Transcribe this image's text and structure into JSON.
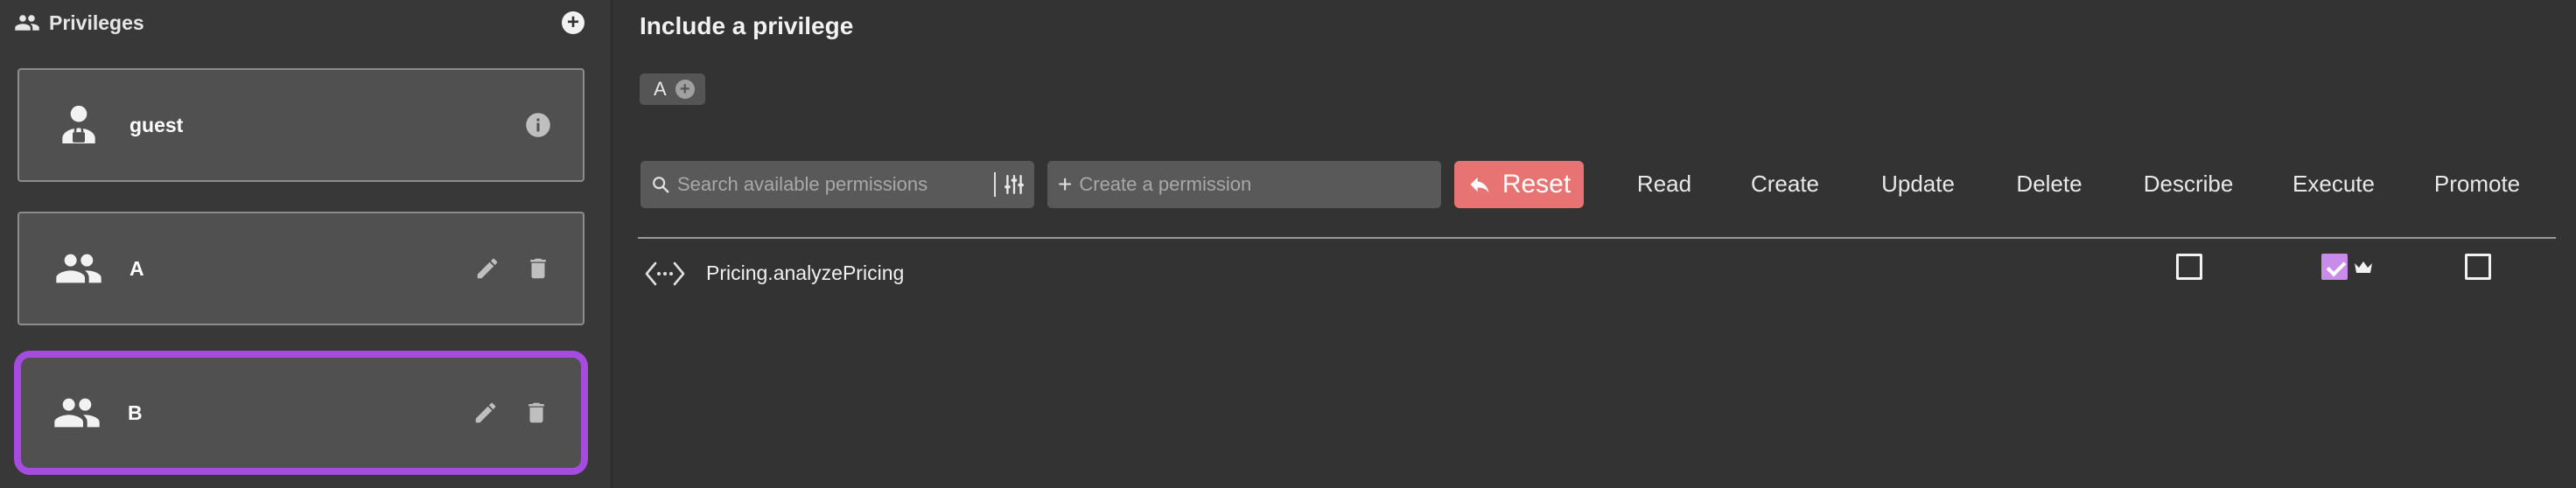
{
  "sidebar": {
    "title": "Privileges",
    "roles": [
      {
        "name": "guest",
        "icon": "user-lock-icon",
        "actions": [
          "info-icon"
        ]
      },
      {
        "name": "A",
        "icon": "group-icon",
        "actions": [
          "edit-icon",
          "delete-icon"
        ]
      },
      {
        "name": "B",
        "icon": "group-icon",
        "actions": [
          "edit-icon",
          "delete-icon"
        ],
        "selected": true
      }
    ]
  },
  "main": {
    "title": "Include a privilege",
    "chips": [
      {
        "label": "A"
      }
    ],
    "search": {
      "placeholder": "Search available permissions"
    },
    "create": {
      "placeholder": "Create a permission"
    },
    "reset_label": "Reset",
    "columns": [
      "Read",
      "Create",
      "Update",
      "Delete",
      "Describe",
      "Execute",
      "Promote"
    ],
    "permissions": [
      {
        "name": "Pricing.analyzePricing",
        "icon": "code-icon",
        "checkboxes": [
          {
            "column": "Describe",
            "checked": false
          },
          {
            "column": "Execute",
            "checked": true,
            "crown": true
          },
          {
            "column": "Promote",
            "checked": false
          }
        ]
      }
    ]
  },
  "colors": {
    "background": "#333333",
    "sidebar": "#383838",
    "card": "#505050",
    "selected_border": "#a64be0",
    "reset": "#e87373",
    "checked": "#c98ce8"
  }
}
